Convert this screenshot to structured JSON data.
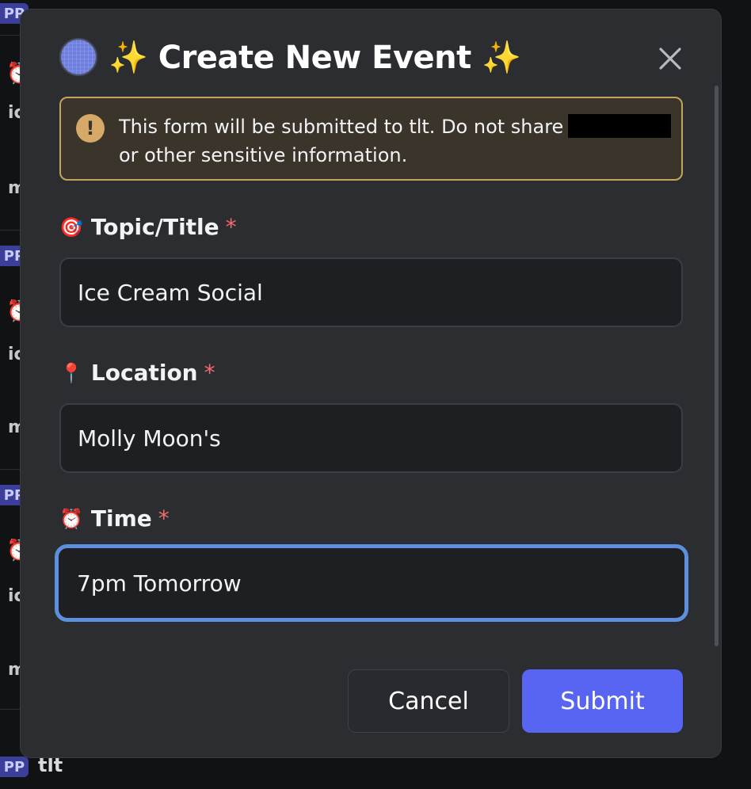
{
  "background": {
    "badge": "PP",
    "user": "tlt",
    "fragment_ic": "ic",
    "fragment_m": "m",
    "clock_icon": "⏰"
  },
  "modal": {
    "title_prefix": "✨",
    "title": "Create New Event",
    "title_suffix": "✨",
    "close_icon": "close-icon",
    "warning": {
      "icon": "!",
      "line1": "This form will be submitted to tlt. Do not share",
      "line2": "or other sensitive information."
    },
    "fields": [
      {
        "emoji": "🎯",
        "label": "Topic/Title",
        "required": "*",
        "value": "Ice Cream Social",
        "focused": false
      },
      {
        "emoji": "📍",
        "label": "Location",
        "required": "*",
        "value": "Molly Moon's",
        "focused": false
      },
      {
        "emoji": "⏰",
        "label": "Time",
        "required": "*",
        "value": "7pm Tomorrow",
        "focused": true
      }
    ],
    "buttons": {
      "cancel": "Cancel",
      "submit": "Submit"
    }
  },
  "colors": {
    "accent": "#5865f2",
    "focus_ring": "#5d8fdc",
    "warning_border": "#c5a261",
    "required": "#f26c6c"
  }
}
